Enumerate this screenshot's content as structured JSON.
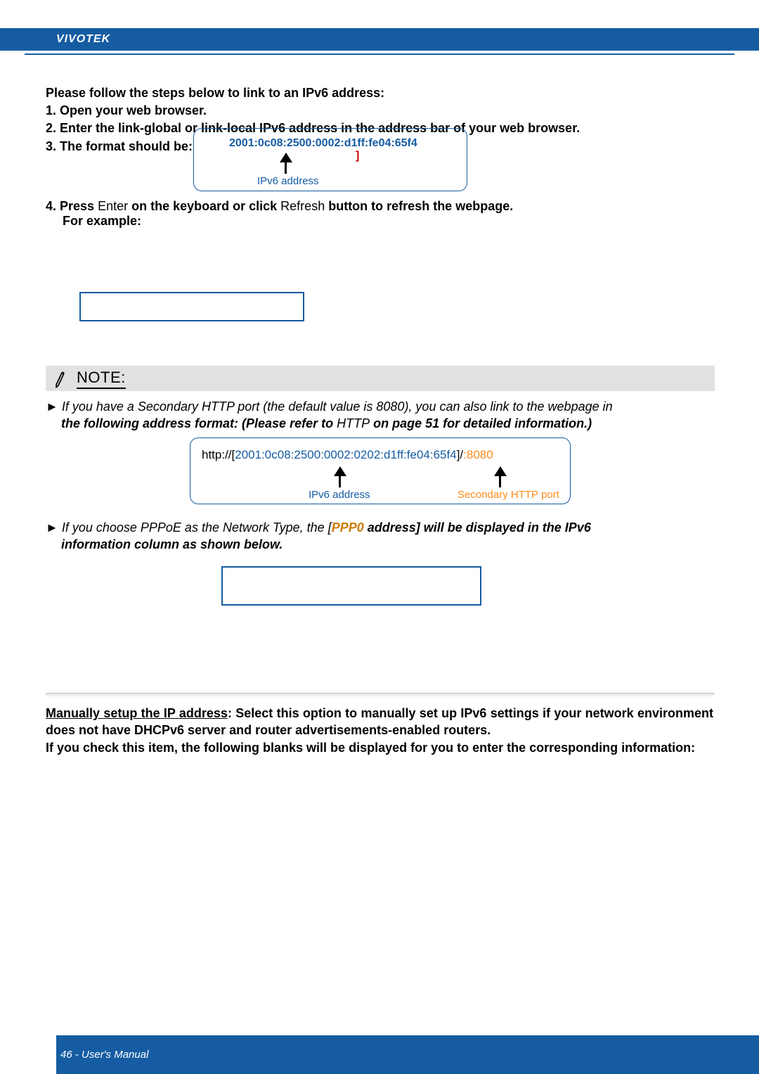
{
  "header": {
    "brand": "VIVOTEK"
  },
  "steps": {
    "heading": "Please follow the steps below to link to an IPv6 address:",
    "s1": "1. Open your web browser.",
    "s2": "2. Enter the link-global or link-local IPv6 address in the address bar of your web browser.",
    "s3": "3. The format should be:"
  },
  "url1": {
    "full": "2001:0c08:2500:0002:d1ff:fe04:65f4",
    "bracketR": "]",
    "ipv6_label": "IPv6 address"
  },
  "step4": {
    "part_a": "4. Press ",
    "part_b": "Enter",
    "part_c": " on the keyboard or click ",
    "part_d": "Refresh",
    "part_e": " button to refresh the webpage.",
    "line2": "For example:"
  },
  "note": {
    "label": "NOTE:"
  },
  "note1": {
    "bullet": "►",
    "text_a": " If you have a Secondary HTTP port (the default value is 8080), you can also link to the webpage in",
    "text_b_prefix": "the following address format: (Please refer to ",
    "text_b_http": "HTTP",
    "text_b_suffix": " on page 51 for detailed information.)"
  },
  "url2": {
    "prefix": "http://",
    "brL": "[",
    "ipv6": "2001:0c08:2500:0002:0202:d1ff:fe04:65f4",
    "brR": "]",
    "slash": "/",
    "port": ":8080",
    "ipv6_label": "IPv6 address",
    "port_label": "Secondary HTTP port"
  },
  "note2": {
    "bullet": "►",
    "text_a": " If you choose PPPoE as the Network Type, the [",
    "ppp0": "PPP0",
    "text_b": " address] will be displayed in the IPv6",
    "text_c": "information column as shown below."
  },
  "manual": {
    "underline": "Manually setup the IP address",
    "rest1": ": Select this option to manually set up IPv6 settings if your network environment does not have DHCPv6 server and router advertisements-enabled routers.",
    "rest2": "If you check this item, the following blanks will be displayed for you to enter the corresponding information:"
  },
  "footer": {
    "page": "46 - User's Manual"
  }
}
